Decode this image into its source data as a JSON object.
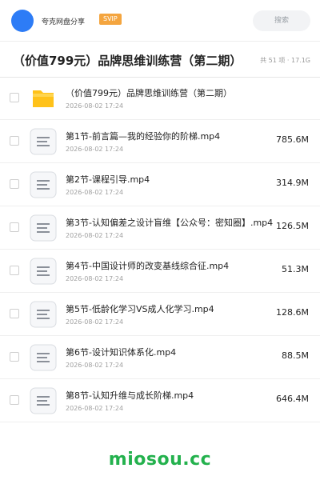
{
  "header": {
    "owner_name": "夸克网盘分享",
    "badge": "SVIP",
    "search_placeholder": "搜索"
  },
  "folder": {
    "title": "（价值799元）品牌思维训练营（第二期）",
    "meta": "共 51 项 · 17.1G"
  },
  "files": [
    {
      "name": "（价值799元）品牌思维训练营（第二期）",
      "date": "2026-08-02 17:24",
      "size": "",
      "type": "folder"
    },
    {
      "name": "第1节-前言篇—我的经验你的阶梯.mp4",
      "date": "2026-08-02 17:24",
      "size": "785.6M",
      "type": "file"
    },
    {
      "name": "第2节-课程引导.mp4",
      "date": "2026-08-02 17:24",
      "size": "314.9M",
      "type": "file"
    },
    {
      "name": "第3节-认知偏差之设计盲维【公众号：密知圈】.mp4",
      "date": "2026-08-02 17:24",
      "size": "126.5M",
      "type": "file"
    },
    {
      "name": "第4节-中国设计师的改变基线综合征.mp4",
      "date": "2026-08-02 17:24",
      "size": "51.3M",
      "type": "file"
    },
    {
      "name": "第5节-低龄化学习VS成人化学习.mp4",
      "date": "2026-08-02 17:24",
      "size": "128.6M",
      "type": "file"
    },
    {
      "name": "第6节-设计知识体系化.mp4",
      "date": "2026-08-02 17:24",
      "size": "88.5M",
      "type": "file"
    },
    {
      "name": "第8节-认知升维与成长阶梯.mp4",
      "date": "2026-08-02 17:24",
      "size": "646.4M",
      "type": "file"
    }
  ],
  "watermark": "miosou.cc",
  "colors": {
    "accent": "#2d7cf6",
    "svip": "#f4a53f",
    "folder": "#ffc21a",
    "watermark": "#23b14d"
  }
}
